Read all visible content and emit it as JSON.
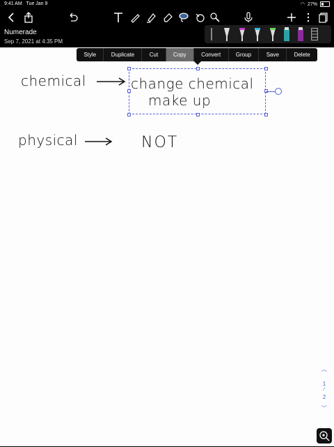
{
  "status": {
    "time": "9:41 AM",
    "date": "Tue Jan 9",
    "battery": "27%"
  },
  "note": {
    "title": "Numerade",
    "date": "Sep 7, 2021 at 4:35 PM"
  },
  "menu": {
    "items": [
      "Style",
      "Duplicate",
      "Cut",
      "Copy",
      "Convert",
      "Group",
      "Save",
      "Delete"
    ],
    "active": "Copy"
  },
  "handwriting": {
    "line1_left": "chemical",
    "line1_right_top": "change chemical",
    "line1_right_bottom": "make up",
    "line2_left": "physical",
    "line2_right": "NOT"
  },
  "pager": {
    "current": "1",
    "total": "2"
  },
  "colors": {
    "accent": "#5560d8",
    "pink": "#c33cc6",
    "teal": "#2aa3a3",
    "green": "#6dd35a",
    "purple": "#8a2b9a"
  },
  "icons": {
    "toolbar": [
      "back-icon",
      "share-icon",
      "undo-icon",
      "text-tool-icon",
      "pen-tool-icon",
      "highlighter-icon",
      "eraser-icon",
      "lasso-icon",
      "shape-icon",
      "image-icon",
      "microphone-icon",
      "add-icon",
      "more-icon",
      "pages-icon"
    ]
  }
}
